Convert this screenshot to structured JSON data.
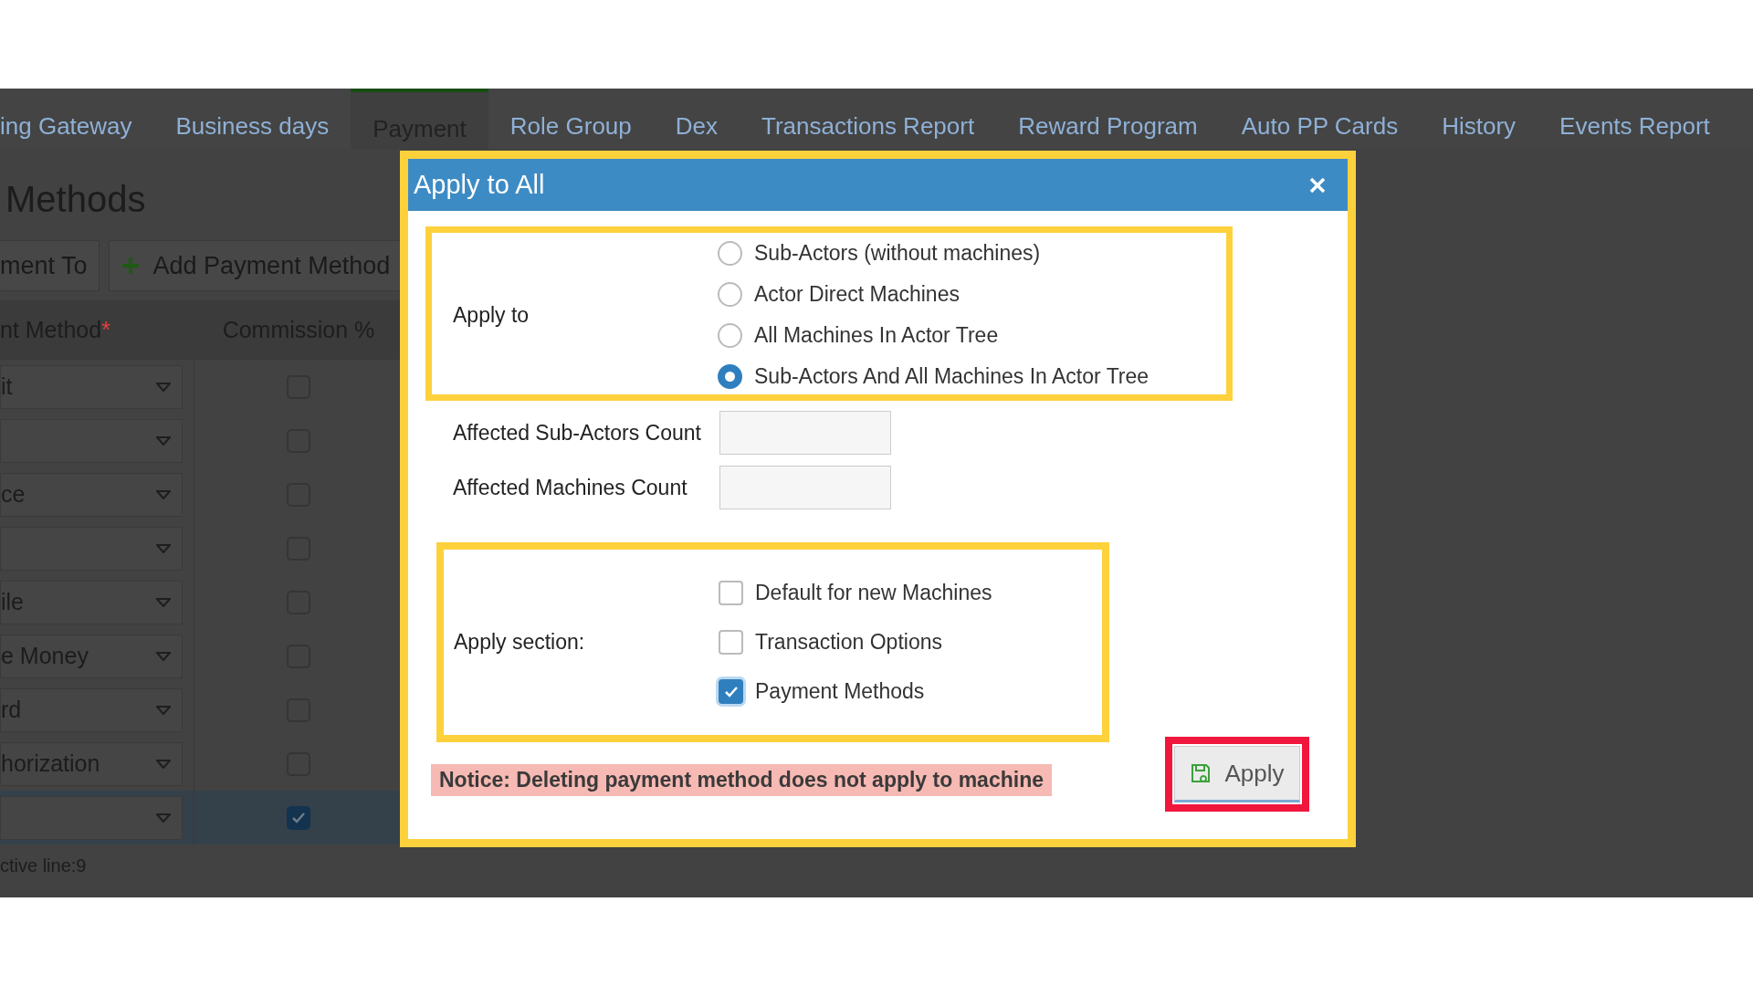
{
  "tabs": [
    {
      "label": "ing Gateway",
      "selected": false
    },
    {
      "label": "Business days",
      "selected": false
    },
    {
      "label": "Payment",
      "selected": true
    },
    {
      "label": "Role Group",
      "selected": false
    },
    {
      "label": "Dex",
      "selected": false
    },
    {
      "label": "Transactions Report",
      "selected": false
    },
    {
      "label": "Reward Program",
      "selected": false
    },
    {
      "label": "Auto PP Cards",
      "selected": false
    },
    {
      "label": "History",
      "selected": false
    },
    {
      "label": "Events Report",
      "selected": false
    }
  ],
  "page_title": "Methods",
  "toolbar": [
    {
      "label": "ment To",
      "kind": "plain"
    },
    {
      "label": "Add Payment Method",
      "kind": "add"
    }
  ],
  "grid": {
    "columns": [
      {
        "label": "nt Method",
        "required_mark": "*"
      },
      {
        "label": "Commission %"
      }
    ],
    "rows": [
      {
        "method": "it",
        "checked": false,
        "selected": false
      },
      {
        "method": "",
        "checked": false,
        "selected": false
      },
      {
        "method": "ce",
        "checked": false,
        "selected": false
      },
      {
        "method": "",
        "checked": false,
        "selected": false
      },
      {
        "method": "ile",
        "checked": false,
        "selected": false
      },
      {
        "method": "e Money",
        "checked": false,
        "selected": false
      },
      {
        "method": "rd",
        "checked": false,
        "selected": false
      },
      {
        "method": "horization",
        "checked": false,
        "selected": false
      },
      {
        "method": "",
        "checked": true,
        "selected": true
      }
    ],
    "status": "ctive line:9"
  },
  "dialog": {
    "title": "Apply to All",
    "apply_to": {
      "label": "Apply to",
      "options": [
        {
          "label": "Sub-Actors (without machines)",
          "selected": false
        },
        {
          "label": "Actor Direct Machines",
          "selected": false
        },
        {
          "label": "All Machines In Actor Tree",
          "selected": false
        },
        {
          "label": "Sub-Actors And All Machines In Actor Tree",
          "selected": true
        }
      ]
    },
    "fields": [
      {
        "label": "Affected Sub-Actors Count"
      },
      {
        "label": "Affected Machines Count"
      }
    ],
    "apply_section": {
      "label": "Apply section:",
      "options": [
        {
          "label": "Default for new Machines",
          "checked": false
        },
        {
          "label": "Transaction Options",
          "checked": false
        },
        {
          "label": "Payment Methods",
          "checked": true
        }
      ]
    },
    "notice": "Notice: Deleting payment method does not apply to machine",
    "apply_button": "Apply"
  }
}
